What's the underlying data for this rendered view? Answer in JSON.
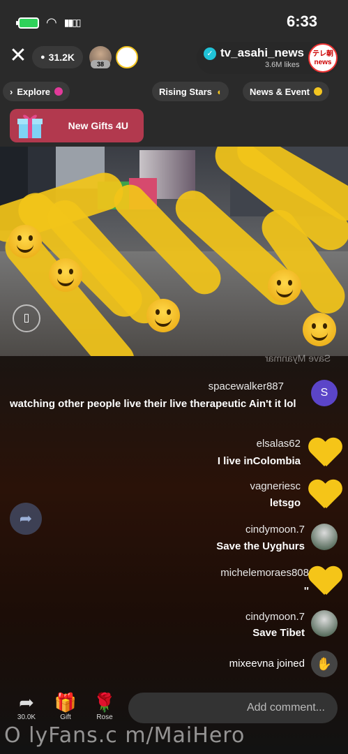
{
  "status": {
    "time": "6:33"
  },
  "header": {
    "viewers": "31.2K",
    "viewer_level": "38",
    "host_name": "tv_asahi_news",
    "host_likes": "3.6M likes",
    "host_avatar_text": "テレ朝 news"
  },
  "chips": [
    {
      "label": "Explore"
    },
    {
      "label": "Rising Stars"
    },
    {
      "label": "News & Event"
    }
  ],
  "gift_banner": {
    "label": "New Gifts 4U"
  },
  "video": {
    "overlay_label": "Save Myanmar"
  },
  "chat": [
    {
      "user": "spacewalker887",
      "message": "watching other people live their live therapeutic Ain't it lol",
      "avatar": "S"
    },
    {
      "user": "elsalas62",
      "message": "I live inColombia"
    },
    {
      "user": "vagneriesc",
      "message": "letsgo"
    },
    {
      "user": "cindymoon.7",
      "message": "Save the Uyghurs"
    },
    {
      "user": "michelemoraes808",
      "message": "''"
    },
    {
      "user": "cindymoon.7",
      "message": "Save Tibet"
    },
    {
      "user": "",
      "message": "mixeevna joined"
    }
  ],
  "bottom": {
    "comment_placeholder": "Add comment...",
    "share_count": "30.0K",
    "gift_label": "Gift",
    "rose_label": "Rose"
  },
  "watermark": "O lyFans.c m/MaiHero",
  "colors": {
    "highlight": "#f2c419",
    "gift_banner": "#b2394e",
    "verified": "#20c3d8"
  }
}
